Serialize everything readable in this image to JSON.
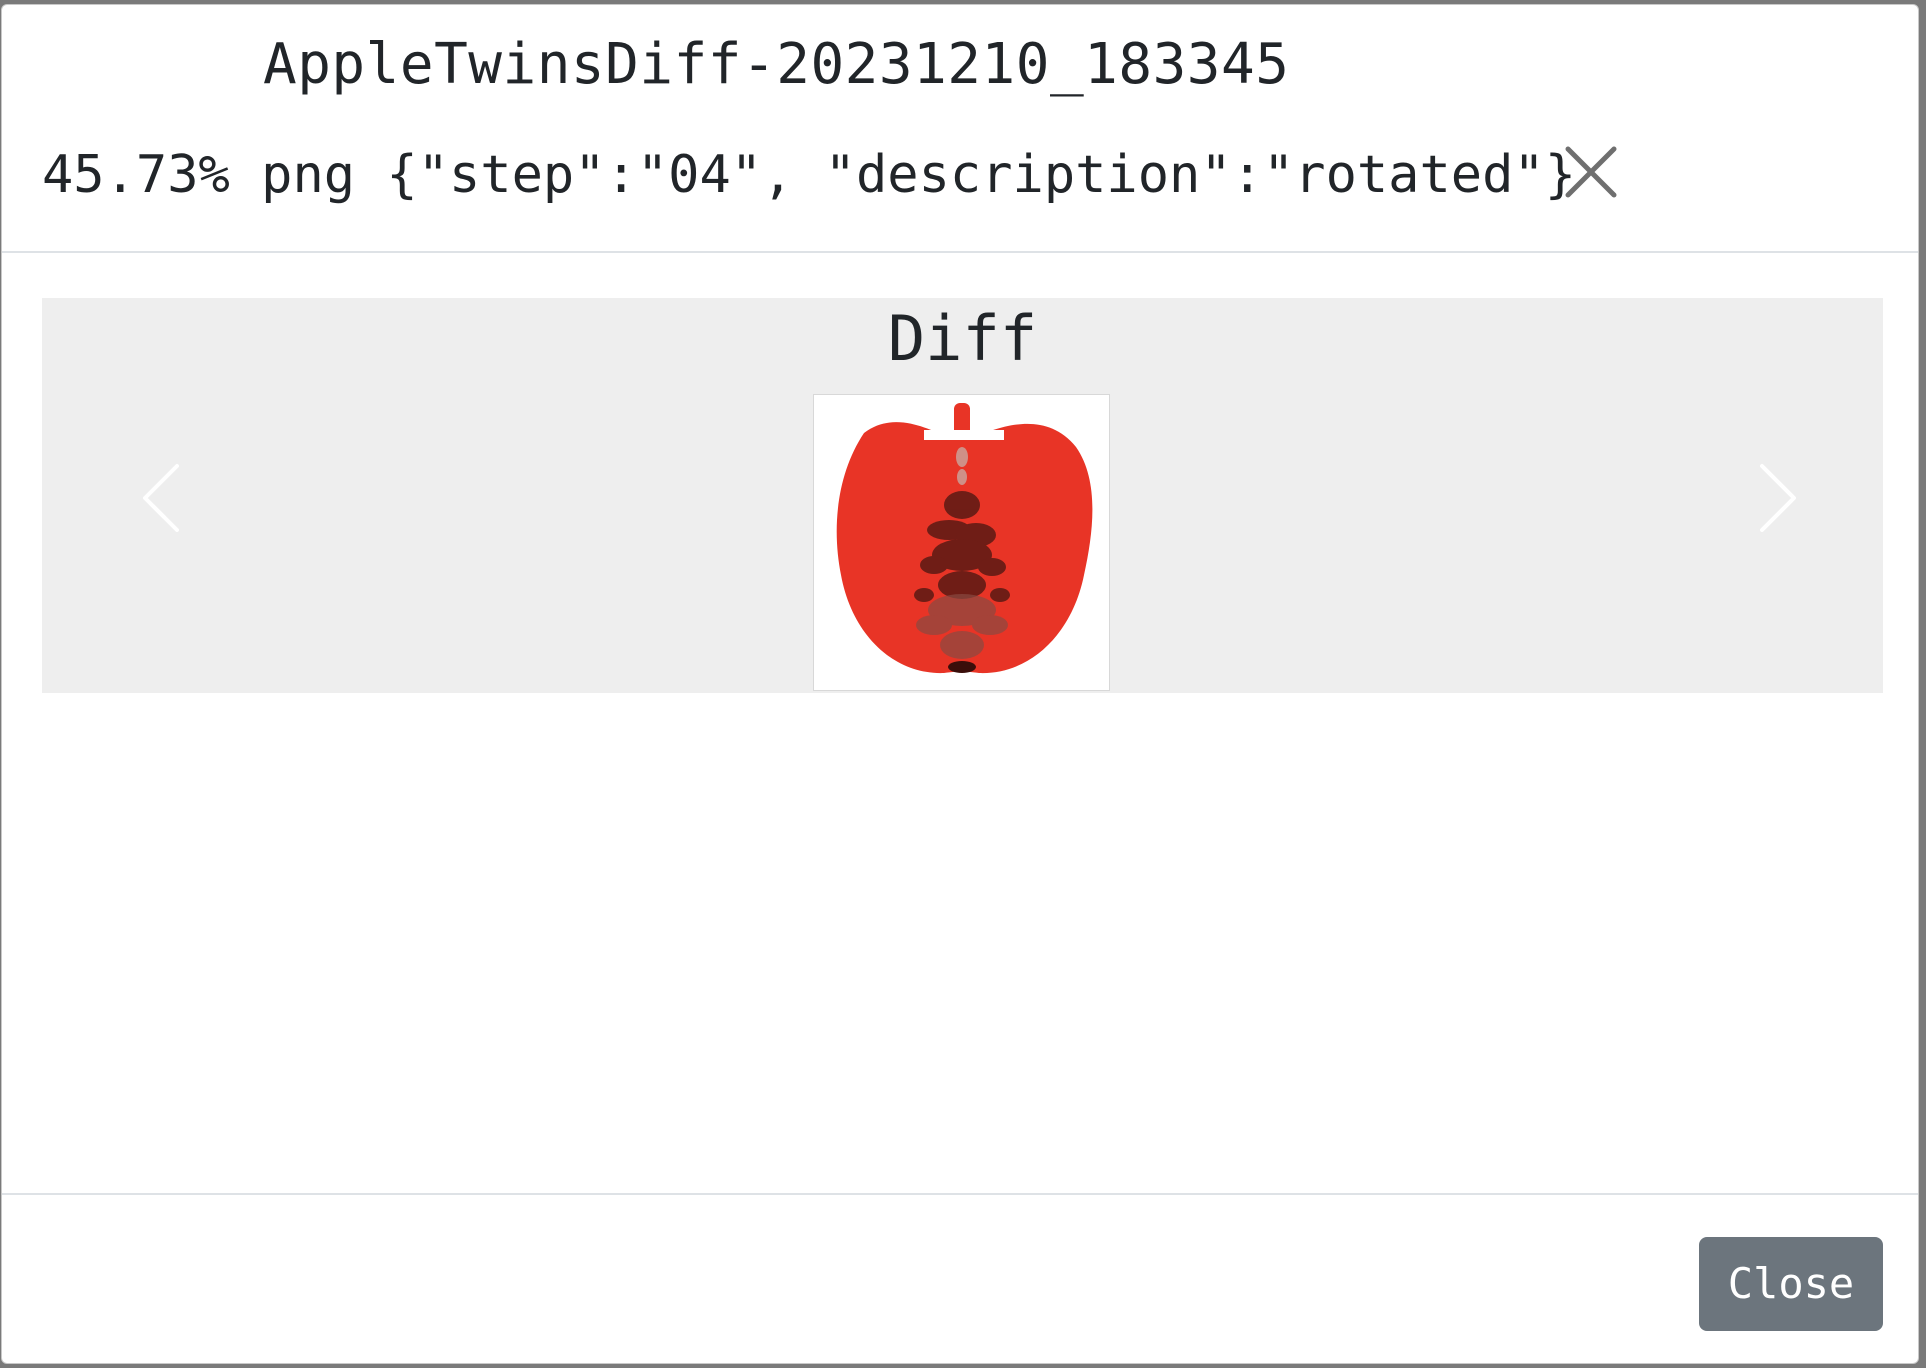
{
  "modal": {
    "title": "AppleTwinsDiff-20231210_183345",
    "subtitle": "45.73% png {\"step\":\"04\", \"description\":\"rotated\"}",
    "close_icon": "close-icon"
  },
  "carousel": {
    "caption": "Diff",
    "image_subject": "red-apple-diff",
    "prev_icon": "chevron-left-icon",
    "next_icon": "chevron-right-icon"
  },
  "footer": {
    "close_label": "Close"
  },
  "colors": {
    "button_secondary": "#6c757d",
    "carousel_bg": "#eeeeee",
    "apple_red": "#e83426",
    "diff_dark": "#5a1a14"
  }
}
